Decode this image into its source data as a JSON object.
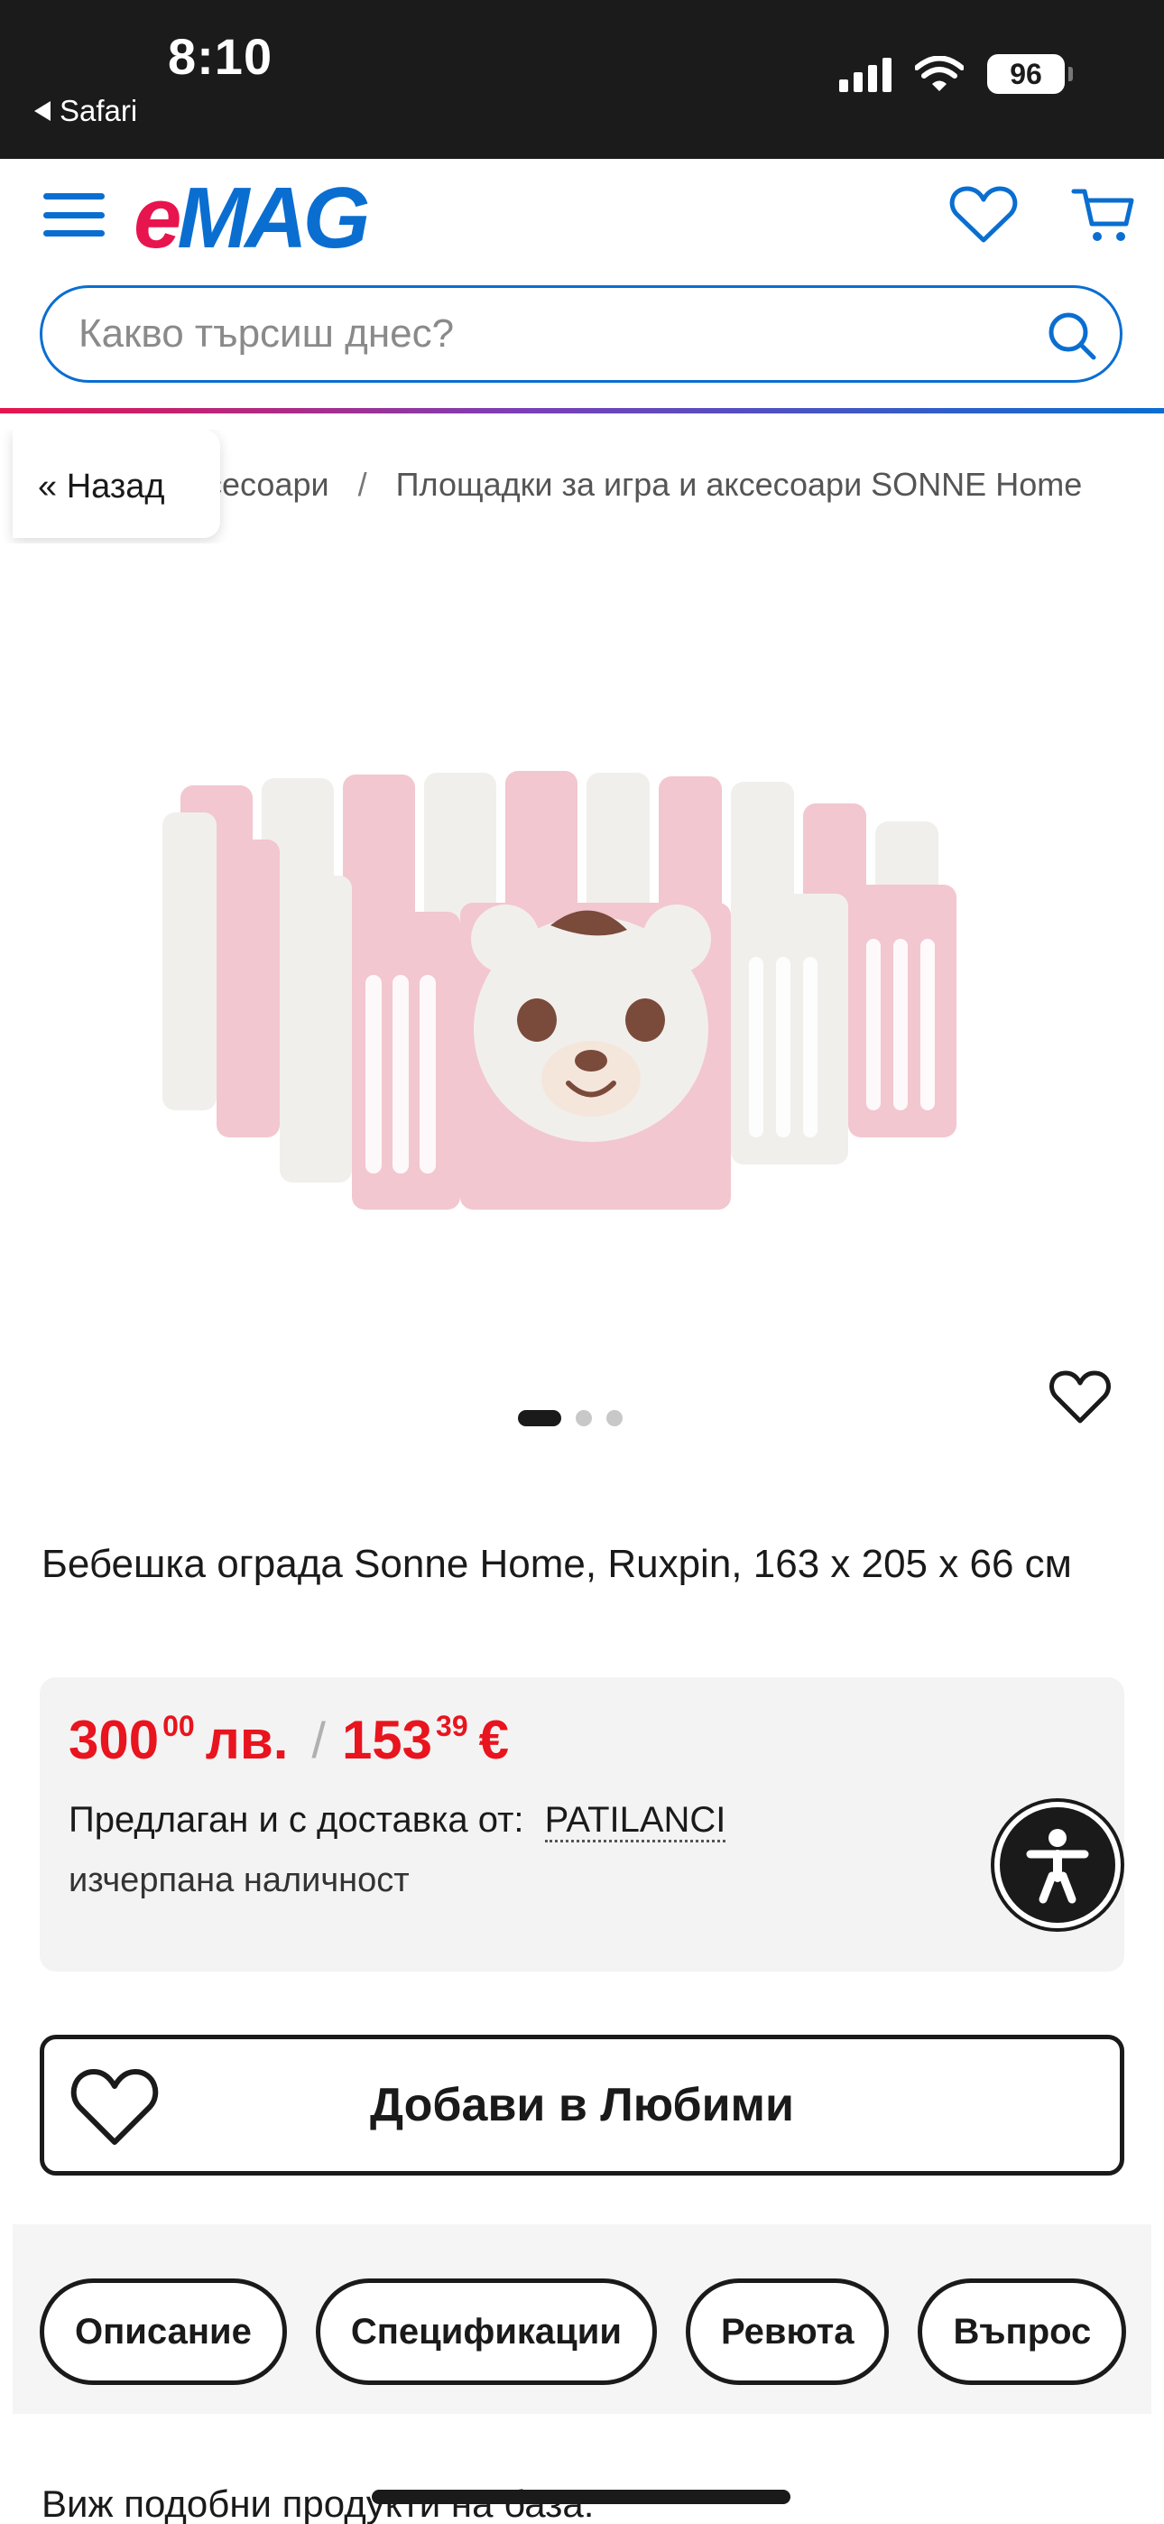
{
  "status_bar": {
    "time": "8:10",
    "back_app": "Safari",
    "battery": "96"
  },
  "header": {
    "logo_e": "e",
    "logo_mag": "MAG",
    "search_placeholder": "Какво търсиш днес?"
  },
  "breadcrumb": {
    "back_label": "« Назад",
    "items": [
      "сесоари",
      "Площадки за игра и аксесоари SONNE Home"
    ],
    "separator": "/"
  },
  "gallery": {
    "image_count": 3,
    "active_index": 0
  },
  "product": {
    "title": "Бебешка ограда Sonne Home, Ruxpin, 163 x 205 x 66 см",
    "price_bgn_int": "300",
    "price_bgn_dec": "00",
    "price_bgn_cur": "лв.",
    "price_sep": "/",
    "price_eur_int": "153",
    "price_eur_dec": "39",
    "price_eur_cur": "€",
    "seller_label": "Предлаган и с доставка от:",
    "seller_name": "PATILANCI",
    "stock_status": "изчерпана наличност"
  },
  "actions": {
    "add_favorites": "Добави в Любими"
  },
  "tabs": [
    "Описание",
    "Спецификации",
    "Ревюта",
    "Въпрос"
  ],
  "similar_heading": "Виж подобни продукти на база:",
  "colors": {
    "emag_red": "#e8144e",
    "emag_blue": "#0a6ed1",
    "price_red": "#e8141e"
  }
}
